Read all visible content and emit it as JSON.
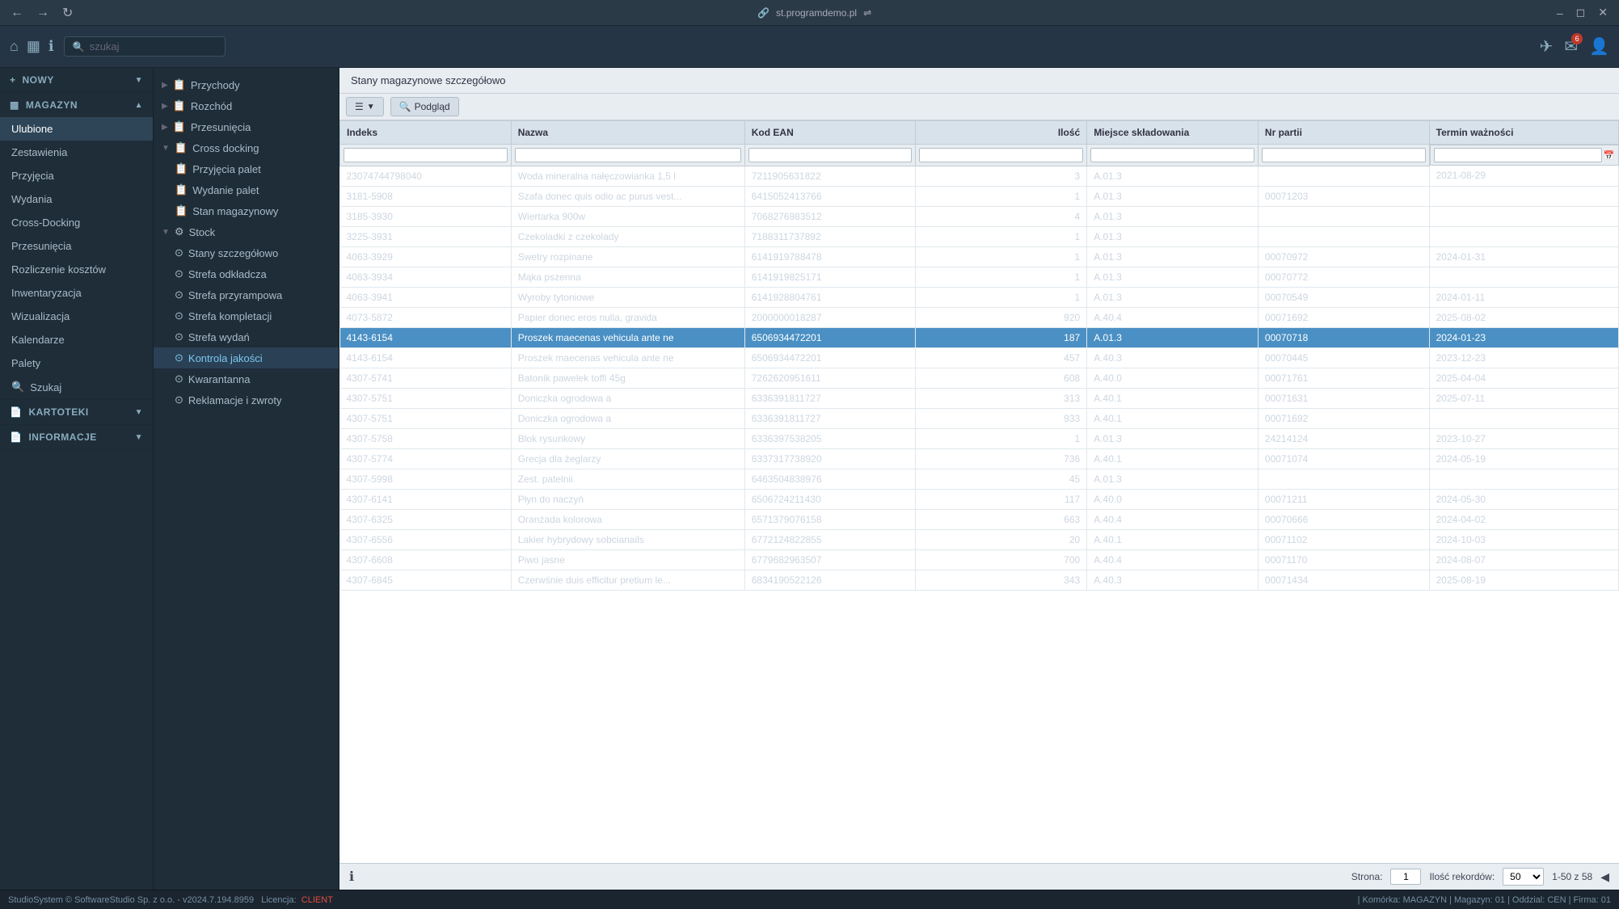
{
  "titlebar": {
    "url": "st.programdemo.pl",
    "controls": [
      "minimize",
      "maximize",
      "close"
    ]
  },
  "toolbar": {
    "search_placeholder": "szukaj",
    "notification_count": "6"
  },
  "sidebar": {
    "sections": [
      {
        "id": "nowy",
        "label": "NOWY",
        "icon": "+"
      },
      {
        "id": "magazyn",
        "label": "MAGAZYN",
        "icon": "▦",
        "items": [
          {
            "id": "ulubione",
            "label": "Ulubione",
            "active": true
          },
          {
            "id": "zestawienia",
            "label": "Zestawienia"
          },
          {
            "id": "przyjecia",
            "label": "Przyjęcia"
          },
          {
            "id": "wydania",
            "label": "Wydania"
          },
          {
            "id": "cross-docking",
            "label": "Cross-Docking"
          },
          {
            "id": "przesunecia",
            "label": "Przesunięcia"
          },
          {
            "id": "rozliczenie",
            "label": "Rozliczenie kosztów"
          },
          {
            "id": "inwentaryzacja",
            "label": "Inwentaryzacja"
          },
          {
            "id": "wizualizacja",
            "label": "Wizualizacja"
          },
          {
            "id": "kalendarze",
            "label": "Kalendarze"
          },
          {
            "id": "palety",
            "label": "Palety"
          },
          {
            "id": "szukaj",
            "label": "Szukaj"
          }
        ]
      },
      {
        "id": "kartoteki",
        "label": "KARTOTEKI"
      },
      {
        "id": "informacje",
        "label": "INFORMACJE"
      }
    ]
  },
  "nav_tree": {
    "items": [
      {
        "id": "przychody",
        "label": "Przychody",
        "level": 0,
        "expanded": false,
        "has_children": true
      },
      {
        "id": "rozchod",
        "label": "Rozchód",
        "level": 0,
        "expanded": false,
        "has_children": true
      },
      {
        "id": "przesunecia",
        "label": "Przesunięcia",
        "level": 0,
        "expanded": false,
        "has_children": true
      },
      {
        "id": "cross-docking",
        "label": "Cross docking",
        "level": 0,
        "expanded": true,
        "has_children": true
      },
      {
        "id": "przyjecia-palet",
        "label": "Przyjęcia palet",
        "level": 1
      },
      {
        "id": "wydanie-palet",
        "label": "Wydanie palet",
        "level": 1
      },
      {
        "id": "stan-magazynowy",
        "label": "Stan magazynowy",
        "level": 1
      },
      {
        "id": "stock",
        "label": "Stock",
        "level": 0,
        "expanded": true,
        "has_children": true
      },
      {
        "id": "stany-szczegolowo",
        "label": "Stany szczegółowo",
        "level": 1
      },
      {
        "id": "strefa-odkladcza",
        "label": "Strefa odkładcza",
        "level": 1
      },
      {
        "id": "strefa-przyrampowa",
        "label": "Strefa przyrampowa",
        "level": 1
      },
      {
        "id": "strefa-kompletacji",
        "label": "Strefa kompletacji",
        "level": 1
      },
      {
        "id": "strefa-wydan",
        "label": "Strefa wydań",
        "level": 1
      },
      {
        "id": "kontrola-jakosci",
        "label": "Kontrola jakości",
        "level": 1,
        "active": true
      },
      {
        "id": "kwarantanna",
        "label": "Kwarantanna",
        "level": 1
      },
      {
        "id": "reklamacje-zwroty",
        "label": "Reklamacje i zwroty",
        "level": 1
      }
    ]
  },
  "content": {
    "title": "Stany magazynowe szczegółowo",
    "toolbar": {
      "menu_btn": "☰",
      "view_btn": "🔍 Podgląd"
    },
    "table": {
      "columns": [
        {
          "id": "indeks",
          "label": "Indeks"
        },
        {
          "id": "nazwa",
          "label": "Nazwa"
        },
        {
          "id": "kod_ean",
          "label": "Kod EAN"
        },
        {
          "id": "ilosc",
          "label": "Ilość"
        },
        {
          "id": "miejsce_skladowania",
          "label": "Miejsce składowania"
        },
        {
          "id": "nr_partii",
          "label": "Nr partii"
        },
        {
          "id": "termin_waznosci",
          "label": "Termin ważności"
        }
      ],
      "rows": [
        {
          "indeks": "23074744798040",
          "nazwa": "Woda mineralna nałęczowianka 1,5 l",
          "kod_ean": "7211905631822",
          "ilosc": "3",
          "miejsce": "A.01.3",
          "nr_partii": "",
          "termin": "2021-08-29",
          "highlighted": false
        },
        {
          "indeks": "3181-5908",
          "nazwa": "Szafa donec quis odio ac purus vest...",
          "kod_ean": "6415052413766",
          "ilosc": "1",
          "miejsce": "A.01.3",
          "nr_partii": "00071203",
          "termin": "",
          "highlighted": false
        },
        {
          "indeks": "3185-3930",
          "nazwa": "Wiertarka 900w",
          "kod_ean": "7068276983512",
          "ilosc": "4",
          "miejsce": "A.01.3",
          "nr_partii": "",
          "termin": "",
          "highlighted": false
        },
        {
          "indeks": "3225-3931",
          "nazwa": "Czekoladki z czekolady",
          "kod_ean": "7188311737892",
          "ilosc": "1",
          "miejsce": "A.01.3",
          "nr_partii": "",
          "termin": "",
          "highlighted": false
        },
        {
          "indeks": "4063-3929",
          "nazwa": "Swetry rozpinane",
          "kod_ean": "6141919788478",
          "ilosc": "1",
          "miejsce": "A.01.3",
          "nr_partii": "00070972",
          "termin": "2024-01-31",
          "highlighted": false
        },
        {
          "indeks": "4063-3934",
          "nazwa": "Mąka pszenna",
          "kod_ean": "6141919825171",
          "ilosc": "1",
          "miejsce": "A.01.3",
          "nr_partii": "00070772",
          "termin": "",
          "highlighted": false
        },
        {
          "indeks": "4063-3941",
          "nazwa": "Wyroby tytoniowe",
          "kod_ean": "6141928804761",
          "ilosc": "1",
          "miejsce": "A.01.3",
          "nr_partii": "00070549",
          "termin": "2024-01-11",
          "highlighted": false
        },
        {
          "indeks": "4073-5872",
          "nazwa": "Papier donec eros nulla, gravida",
          "kod_ean": "2000000018287",
          "ilosc": "920",
          "miejsce": "A.40.4",
          "nr_partii": "00071692",
          "termin": "2025-08-02",
          "highlighted": false
        },
        {
          "indeks": "4143-6154",
          "nazwa": "Proszek maecenas vehicula ante ne",
          "kod_ean": "6506934472201",
          "ilosc": "187",
          "miejsce": "A.01.3",
          "nr_partii": "00070718",
          "termin": "2024-01-23",
          "highlighted": true
        },
        {
          "indeks": "4143-6154",
          "nazwa": "Proszek maecenas vehicula ante ne",
          "kod_ean": "6506934472201",
          "ilosc": "457",
          "miejsce": "A.40.3",
          "nr_partii": "00070445",
          "termin": "2023-12-23",
          "highlighted": false
        },
        {
          "indeks": "4307-5741",
          "nazwa": "Batonik pawelek toffi 45g",
          "kod_ean": "7262620951611",
          "ilosc": "608",
          "miejsce": "A.40.0",
          "nr_partii": "00071761",
          "termin": "2025-04-04",
          "highlighted": false
        },
        {
          "indeks": "4307-5751",
          "nazwa": "Doniczka ogrodowa a",
          "kod_ean": "6336391811727",
          "ilosc": "313",
          "miejsce": "A.40.1",
          "nr_partii": "00071631",
          "termin": "2025-07-11",
          "highlighted": false
        },
        {
          "indeks": "4307-5751",
          "nazwa": "Doniczka ogrodowa a",
          "kod_ean": "6336391811727",
          "ilosc": "933",
          "miejsce": "A.40.1",
          "nr_partii": "00071692",
          "termin": "",
          "highlighted": false
        },
        {
          "indeks": "4307-5758",
          "nazwa": "Blok rysunkowy",
          "kod_ean": "6336397538205",
          "ilosc": "1",
          "miejsce": "A.01.3",
          "nr_partii": "24214124",
          "termin": "2023-10-27",
          "highlighted": false
        },
        {
          "indeks": "4307-5774",
          "nazwa": "Grecja dla żeglarzy",
          "kod_ean": "6337317738920",
          "ilosc": "736",
          "miejsce": "A.40.1",
          "nr_partii": "00071074",
          "termin": "2024-05-19",
          "highlighted": false
        },
        {
          "indeks": "4307-5998",
          "nazwa": "Zest. patelnii",
          "kod_ean": "6463504838976",
          "ilosc": "45",
          "miejsce": "A.01.3",
          "nr_partii": "",
          "termin": "",
          "highlighted": false
        },
        {
          "indeks": "4307-6141",
          "nazwa": "Płyn do naczyń",
          "kod_ean": "6506724211430",
          "ilosc": "117",
          "miejsce": "A.40.0",
          "nr_partii": "00071211",
          "termin": "2024-05-30",
          "highlighted": false
        },
        {
          "indeks": "4307-6325",
          "nazwa": "Oranżada kolorowa",
          "kod_ean": "6571379076158",
          "ilosc": "663",
          "miejsce": "A.40.4",
          "nr_partii": "00070666",
          "termin": "2024-04-02",
          "highlighted": false
        },
        {
          "indeks": "4307-6556",
          "nazwa": "Lakier hybrydowy sobcianails",
          "kod_ean": "6772124822855",
          "ilosc": "20",
          "miejsce": "A.40.1",
          "nr_partii": "00071102",
          "termin": "2024-10-03",
          "highlighted": false
        },
        {
          "indeks": "4307-6608",
          "nazwa": "Piwo jasne",
          "kod_ean": "6779682963507",
          "ilosc": "700",
          "miejsce": "A.40.4",
          "nr_partii": "00071170",
          "termin": "2024-08-07",
          "highlighted": false
        },
        {
          "indeks": "4307-6845",
          "nazwa": "Czerwśnie duis efficitur pretium le...",
          "kod_ean": "6834190522126",
          "ilosc": "343",
          "miejsce": "A.40.3",
          "nr_partii": "00071434",
          "termin": "2025-08-19",
          "highlighted": false
        }
      ]
    },
    "pagination": {
      "page_label": "Strona:",
      "page_value": "1",
      "records_label": "Ilość rekordów:",
      "records_value": "50",
      "range": "1-50 z 58"
    }
  },
  "status_bar": {
    "left": "StudioSystem © SoftwareStudio Sp. z o.o. - v2024.7.194.8959",
    "license_label": "Licencja:",
    "license_value": "CLIENT",
    "right": "| Komórka: MAGAZYN | Magazyn: 01 | Oddzial: CEN | Firma: 01"
  }
}
